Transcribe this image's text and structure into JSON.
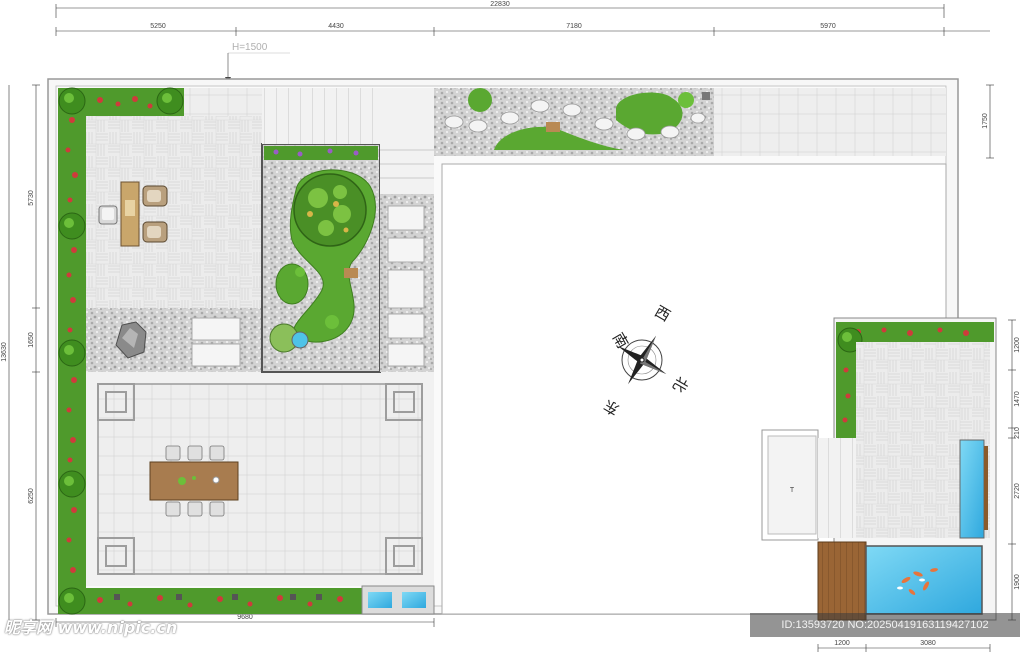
{
  "dims": {
    "total": "22830",
    "top": [
      "5250",
      "4430",
      "7180",
      "5970"
    ],
    "left_total": "13630",
    "left": [
      "5730",
      "1650",
      "6250"
    ],
    "right_top": "1750",
    "right": [
      "1200",
      "1470",
      "210",
      "2720",
      "1900"
    ],
    "bottom_left": "9680",
    "bottom_right": [
      "1200",
      "3080"
    ]
  },
  "height_note": "H=1500",
  "compass": {
    "south": "南",
    "west": "西",
    "north": "北",
    "east": "东"
  },
  "door_label": "T",
  "watermark": {
    "site": "昵享网 www.nipic.cn",
    "id": "ID:13593720 NO:20250419163119427102"
  },
  "colors": {
    "paving": "#e8e8e8",
    "grass": "#5aa831",
    "water": "#4fc3e8",
    "wood": "#8a5a2b",
    "gravel": "#c9c9c9",
    "flowers": "#d9534f"
  }
}
